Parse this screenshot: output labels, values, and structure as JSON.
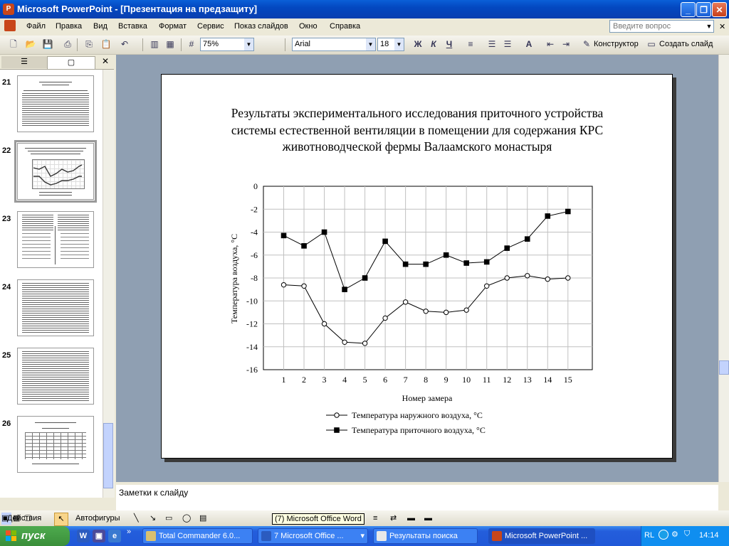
{
  "window": {
    "title": "Microsoft PowerPoint - [Презентация на предзащиту]",
    "buttons": [
      "minimize",
      "restore",
      "close"
    ]
  },
  "menu": {
    "items": [
      "Файл",
      "Правка",
      "Вид",
      "Вставка",
      "Формат",
      "Сервис",
      "Показ слайдов",
      "Окно",
      "Справка"
    ],
    "help_placeholder": "Введите вопрос"
  },
  "toolbar": {
    "zoom": "75%",
    "font": "Arial",
    "font_size": "18",
    "bold": "Ж",
    "italic": "К",
    "underline": "Ч",
    "designer": "Конструктор",
    "new_slide": "Создать слайд"
  },
  "slide_panel": {
    "tabs": [
      "outline",
      "slides"
    ],
    "thumbs": [
      {
        "num": "21",
        "kind": "table"
      },
      {
        "num": "22",
        "kind": "chart",
        "selected": true
      },
      {
        "num": "23",
        "kind": "two-tables"
      },
      {
        "num": "24",
        "kind": "text"
      },
      {
        "num": "25",
        "kind": "text"
      },
      {
        "num": "26",
        "kind": "table"
      }
    ]
  },
  "slide": {
    "title": "Результаты экспериментального исследования приточного устройства системы естественной вентиляции в помещении для содержания КРС животноводческой фермы Валаамского монастыря"
  },
  "chart_data": {
    "type": "line",
    "x": [
      1,
      2,
      3,
      4,
      5,
      6,
      7,
      8,
      9,
      10,
      11,
      12,
      13,
      14,
      15
    ],
    "xlabel": "Номер замера",
    "ylabel": "Температура воздуха, °С",
    "ylim": [
      -16,
      0
    ],
    "yticks": [
      0,
      -2,
      -4,
      -6,
      -8,
      -10,
      -12,
      -14,
      -16
    ],
    "grid": true,
    "legend_position": "bottom",
    "series": [
      {
        "name": "Температура наружного воздуха, °С",
        "marker": "open-circle",
        "values": [
          -8.6,
          -8.7,
          -12.0,
          -13.6,
          -13.7,
          -11.5,
          -10.1,
          -10.9,
          -11.0,
          -10.8,
          -8.7,
          -8.0,
          -7.8,
          -8.1,
          -8.0
        ]
      },
      {
        "name": "Температура приточного воздуха, °С",
        "marker": "filled-square",
        "values": [
          -4.3,
          -5.2,
          -4.0,
          -9.0,
          -8.0,
          -4.8,
          -6.8,
          -6.8,
          -6.0,
          -6.7,
          -6.6,
          -5.4,
          -4.6,
          -2.6,
          -2.2
        ]
      }
    ]
  },
  "notes": {
    "placeholder": "Заметки к слайду"
  },
  "drawbar": {
    "actions": "Действия",
    "autoshapes": "Автофигуры",
    "tooltip": "(7) Microsoft Office Word"
  },
  "taskbar": {
    "start": "пуск",
    "tasks": [
      {
        "label": "Total Commander 6.0...",
        "active": false
      },
      {
        "label": "7 Microsoft Office ...",
        "active": false
      },
      {
        "label": "Результаты поиска",
        "active": false
      },
      {
        "label": "Microsoft PowerPoint ...",
        "active": true
      }
    ],
    "lang": "RL",
    "clock": "14:14"
  },
  "colors": {
    "titlebar": "#0a4fd0",
    "taskbar": "#245edc",
    "editor_bg": "#8f9fb2",
    "start": "#3a8f3a"
  }
}
